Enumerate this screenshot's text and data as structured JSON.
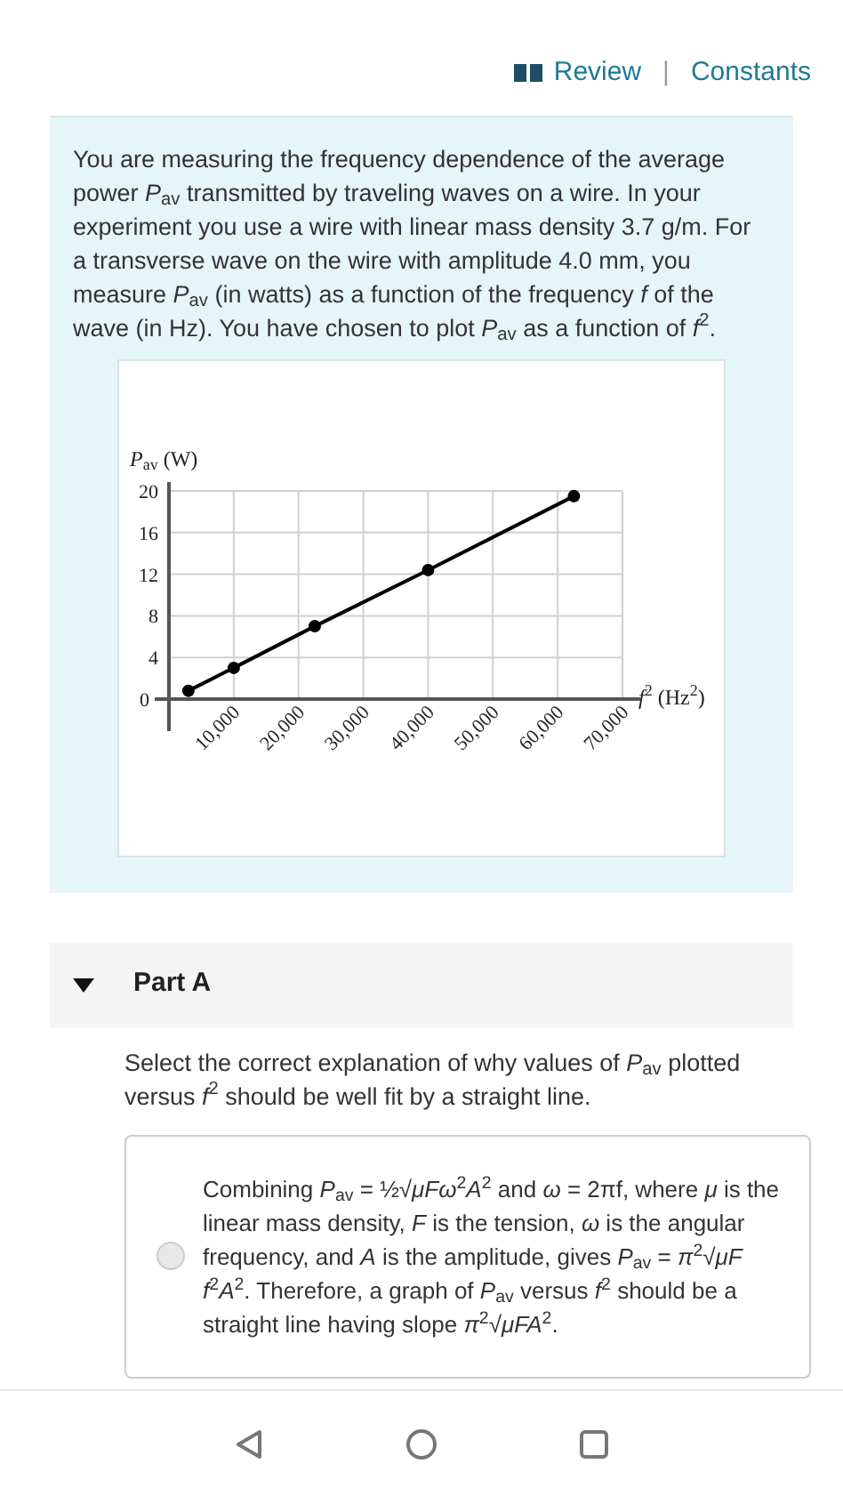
{
  "header": {
    "links": [
      {
        "label": "Review",
        "icon": true
      },
      {
        "label": "Constants",
        "icon": false
      }
    ],
    "separator": "|"
  },
  "intro": {
    "text": "You are measuring the frequency dependence of the average power *P*$_{av}$ transmitted by traveling waves on a wire. In your experiment you use a wire with linear mass density 3.7 g/m. For a transverse wave on the wire with amplitude 4.0 mm, you measure *P*$_{av}$ (in watts) as a function of the frequency *f* of the wave (in Hz). You have chosen to plot *P*$_{av}$ as a function of *f*$^{2}$.",
    "chart_data": {
      "type": "line",
      "grid": true,
      "marker": "o",
      "ylabel": "*P*$_{av}$ (W)",
      "xlabel": "*f*$^{2}$ (Hz$^{2}$)",
      "x": [
        3000,
        10000,
        22500,
        40000,
        62500
      ],
      "values": [
        0.8,
        3,
        7,
        12.4,
        19.5
      ],
      "xlim": [
        0,
        70000
      ],
      "ylim": [
        0,
        20
      ],
      "xticks": [
        {
          "value": 10000,
          "label": "10,000"
        },
        {
          "value": 20000,
          "label": "20,000"
        },
        {
          "value": 30000,
          "label": "30,000"
        },
        {
          "value": 40000,
          "label": "40,000"
        },
        {
          "value": 50000,
          "label": "50,000"
        },
        {
          "value": 60000,
          "label": "60,000"
        },
        {
          "value": 70000,
          "label": "70,000"
        }
      ],
      "yticks": [
        0,
        4,
        8,
        12,
        16,
        20
      ]
    }
  },
  "part": {
    "title": "Part A",
    "expanded": true,
    "question": "Select the correct explanation of why values of *P*$_{av}$ plotted versus *f*$^{2}$ should be well fit by a straight line.",
    "options": [
      {
        "text": "Combining *P*$_{av}$ = ½√*μFω*$^{2}$*A*$^{2}$ and *ω* = 2πf, where *μ* is the linear mass density, *F* is the tension, *ω* is the angular frequency, and *A* is the amplitude, gives *P*$_{av}$ = *π*$^{2}$√*μF f*$^{2}$*A*$^{2}$. Therefore, a graph of *P*$_{av}$ versus *f*$^{2}$ should be a straight line having slope *π*$^{2}$√*μFA*$^{2}$.",
        "selected": false
      }
    ]
  }
}
